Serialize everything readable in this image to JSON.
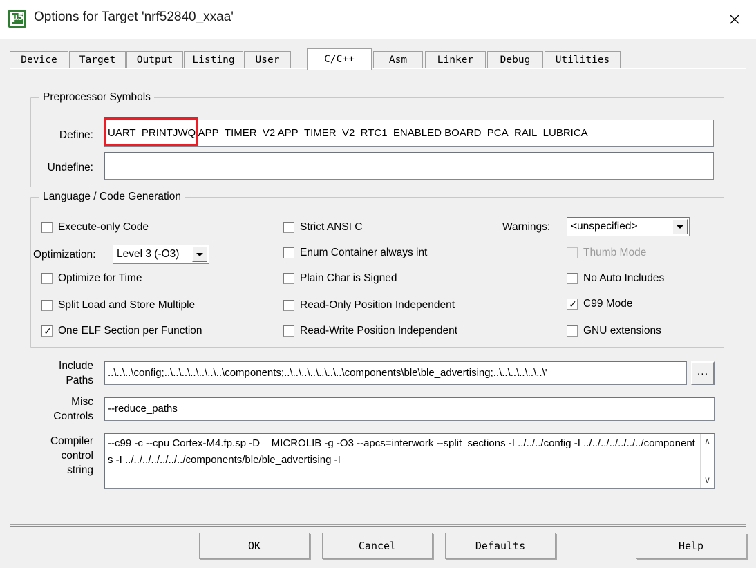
{
  "window": {
    "title": "Options for Target 'nrf52840_xxaa'",
    "app_icon": "keil-uvision5-icon",
    "icon_glyph": "μ5",
    "close_label": "✕"
  },
  "tabs": [
    {
      "label": "Device",
      "active": false
    },
    {
      "label": "Target",
      "active": false
    },
    {
      "label": "Output",
      "active": false
    },
    {
      "label": "Listing",
      "active": false
    },
    {
      "label": "User",
      "active": false
    },
    {
      "label": "C/C++",
      "active": true
    },
    {
      "label": "Asm",
      "active": false
    },
    {
      "label": "Linker",
      "active": false
    },
    {
      "label": "Debug",
      "active": false
    },
    {
      "label": "Utilities",
      "active": false
    }
  ],
  "preprocessor": {
    "group_title": "Preprocessor Symbols",
    "define_label": "Define:",
    "define_value": "UART_PRINTJWQ APP_TIMER_V2 APP_TIMER_V2_RTC1_ENABLED BOARD_PCA_RAIL_LUBRICA",
    "undefine_label": "Undefine:",
    "undefine_value": ""
  },
  "language": {
    "group_title": "Language / Code Generation",
    "col1": [
      {
        "label": "Execute-only Code",
        "checked": false,
        "disabled": false
      },
      {
        "label": "Optimize for Time",
        "checked": false,
        "disabled": false
      },
      {
        "label": "Split Load and Store Multiple",
        "checked": false,
        "disabled": false
      },
      {
        "label": "One ELF Section per Function",
        "checked": true,
        "disabled": false
      }
    ],
    "optimization_label": "Optimization:",
    "optimization_value": "Level 3 (-O3)",
    "col2": [
      {
        "label": "Strict ANSI C",
        "checked": false,
        "disabled": false
      },
      {
        "label": "Enum Container always int",
        "checked": false,
        "disabled": false
      },
      {
        "label": "Plain Char is Signed",
        "checked": false,
        "disabled": false
      },
      {
        "label": "Read-Only Position Independent",
        "checked": false,
        "disabled": false
      },
      {
        "label": "Read-Write Position Independent",
        "checked": false,
        "disabled": false
      }
    ],
    "warnings_label": "Warnings:",
    "warnings_value": "<unspecified>",
    "col3": [
      {
        "label": "Thumb Mode",
        "checked": false,
        "disabled": true
      },
      {
        "label": "No Auto Includes",
        "checked": false,
        "disabled": false
      },
      {
        "label": "C99 Mode",
        "checked": true,
        "disabled": false
      },
      {
        "label": "GNU extensions",
        "checked": false,
        "disabled": false
      }
    ]
  },
  "paths": {
    "include_label_line1": "Include",
    "include_label_line2": "Paths",
    "include_value": "..\\..\\..\\config;..\\..\\..\\..\\..\\..\\..\\components;..\\..\\..\\..\\..\\..\\..\\components\\ble\\ble_advertising;..\\..\\..\\..\\..\\..\\'",
    "browse_label": "...",
    "misc_label_line1": "Misc",
    "misc_label_line2": "Controls",
    "misc_value": "--reduce_paths",
    "compiler_label_line1": "Compiler",
    "compiler_label_line2": "control",
    "compiler_label_line3": "string",
    "compiler_value": "--c99 -c --cpu Cortex-M4.fp.sp -D__MICROLIB -g -O3 --apcs=interwork --split_sections -I ../../../config -I ../../../../../../../components -I ../../../../../../../components/ble/ble_advertising -I",
    "scroll_up": "∧",
    "scroll_down": "∨"
  },
  "footer": {
    "ok": "OK",
    "cancel": "Cancel",
    "defaults": "Defaults",
    "help": "Help"
  },
  "annotation": {
    "color": "#ee1c25",
    "target": "UART_PRINT"
  }
}
